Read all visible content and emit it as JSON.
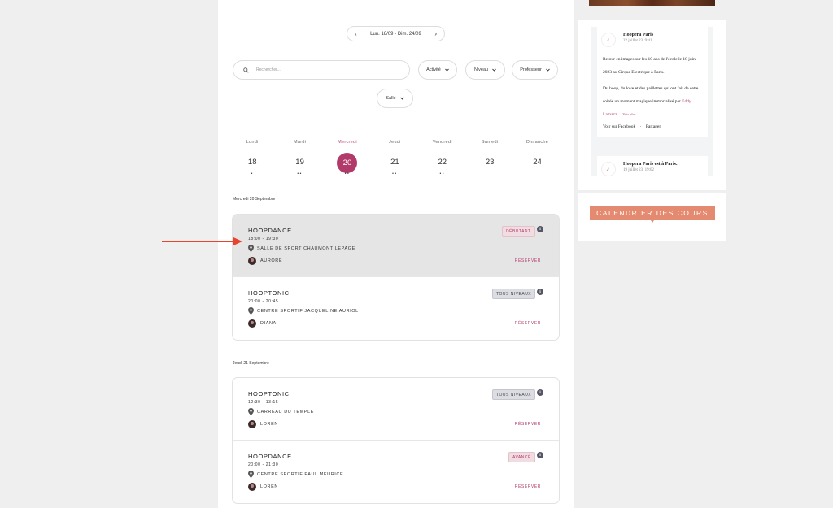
{
  "week_nav": {
    "range": "Lun. 18/09 - Dim. 24/09",
    "prev": "‹",
    "next": "›"
  },
  "filters": {
    "search_placeholder": "Rechercher...",
    "activite": "Activité",
    "niveau": "Niveau",
    "professeur": "Professeur",
    "salle": "Salle"
  },
  "days": [
    {
      "name": "Lundi",
      "num": "18",
      "dots": "•"
    },
    {
      "name": "Mardi",
      "num": "19",
      "dots": "••"
    },
    {
      "name": "Mercredi",
      "num": "20",
      "dots": "••"
    },
    {
      "name": "Jeudi",
      "num": "21",
      "dots": "••"
    },
    {
      "name": "Vendredi",
      "num": "22",
      "dots": "••"
    },
    {
      "name": "Samedi",
      "num": "23",
      "dots": ""
    },
    {
      "name": "Dimanche",
      "num": "24",
      "dots": ""
    }
  ],
  "sections": [
    {
      "date": "Mercredi 20 Septembre",
      "classes": [
        {
          "title": "HOOPDANCE",
          "time": "18:00 - 19:30",
          "location": "SALLE DE SPORT CHAUMONT LEPAGE",
          "teacher": "AURORE",
          "level": "DÉBUTANT",
          "reserve": "RÉSERVER"
        },
        {
          "title": "HOOPTONIC",
          "time": "20:00 - 20:45",
          "location": "CENTRE SPORTIF JACQUELINE AURIOL",
          "teacher": "DIANA",
          "level": "TOUS NIVEAUX",
          "reserve": "RÉSERVER"
        }
      ]
    },
    {
      "date": "Jeudi 21 Septembre",
      "classes": [
        {
          "title": "HOOPTONIC",
          "time": "12:30 - 13:15",
          "location": "CARREAU DU TEMPLE",
          "teacher": "LOREN",
          "level": "TOUS NIVEAUX",
          "reserve": "RÉSERVER"
        },
        {
          "title": "HOOPDANCE",
          "time": "20:00 - 21:30",
          "location": "CENTRE SPORTIF PAUL MEURICE",
          "teacher": "LOREN",
          "level": "AVANCÉ",
          "reserve": "RÉSERVER"
        }
      ]
    }
  ],
  "facebook": {
    "post1": {
      "name": "Hoopera Paris",
      "date": "22 juillet 23, 9:41",
      "p1": "Retour en images sur les 10 ans de l'école le 18 juin 2023 au Cirque Electrique à Paris.",
      "p2": "Du hoop, du love et des paillettes qui ont fait de cette soirée un moment magique immortalisé par",
      "link": "Eddy Lamazz",
      "ellipsis": " ... ",
      "more": "Voir plus",
      "view_fb": "Voir sur Facebook",
      "sep": "·",
      "share": "Partager"
    },
    "post2": {
      "name": "Hoopera Paris est à Paris.",
      "date": "19 juillet 23, 19:02"
    }
  },
  "calendar_banner": "CALENDRIER DES COURS",
  "colors": {
    "accent": "#b23a6a",
    "arrow": "#e8432d",
    "banner": "#e48a70"
  }
}
